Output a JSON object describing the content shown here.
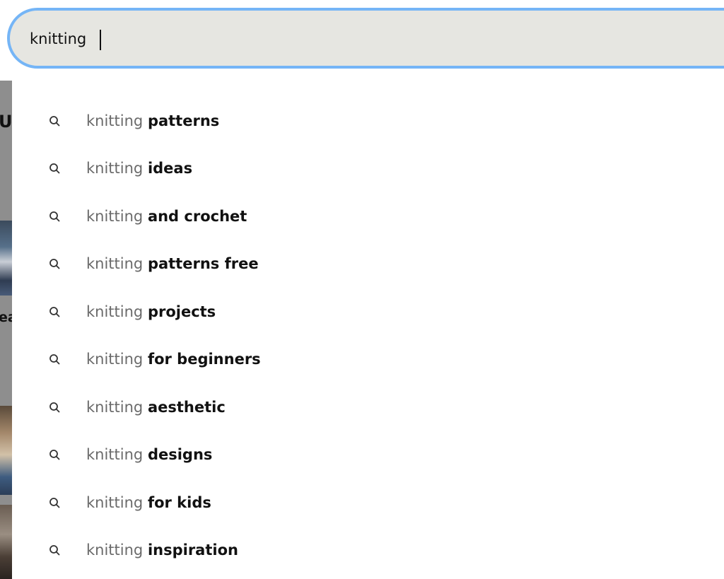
{
  "search": {
    "query": "knitting",
    "accent_color": "#75b5f6",
    "background_color": "#e6e6e1"
  },
  "background": {
    "peek_text_1": "U",
    "peek_text_2": "ea"
  },
  "suggestions": [
    {
      "prefix": "knitting",
      "suffix": "patterns",
      "icon": "search-icon"
    },
    {
      "prefix": "knitting",
      "suffix": "ideas",
      "icon": "search-icon"
    },
    {
      "prefix": "knitting",
      "suffix": "and crochet",
      "icon": "search-icon"
    },
    {
      "prefix": "knitting",
      "suffix": "patterns free",
      "icon": "search-icon"
    },
    {
      "prefix": "knitting",
      "suffix": "projects",
      "icon": "search-icon"
    },
    {
      "prefix": "knitting",
      "suffix": "for beginners",
      "icon": "search-icon"
    },
    {
      "prefix": "knitting",
      "suffix": "aesthetic",
      "icon": "search-icon"
    },
    {
      "prefix": "knitting",
      "suffix": "designs",
      "icon": "search-icon"
    },
    {
      "prefix": "knitting",
      "suffix": "for kids",
      "icon": "search-icon"
    },
    {
      "prefix": "knitting",
      "suffix": "inspiration",
      "icon": "search-icon"
    }
  ]
}
